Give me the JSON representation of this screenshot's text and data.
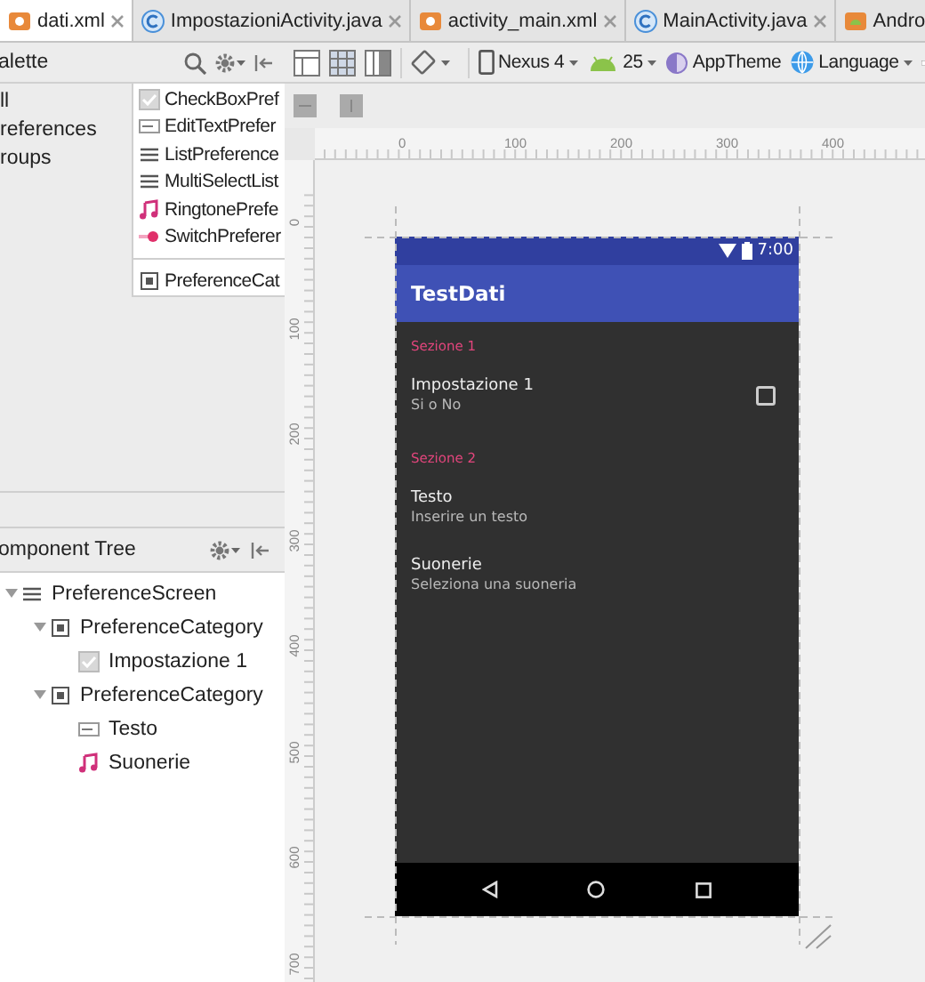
{
  "tabs": [
    {
      "kind": "xml",
      "label": "dati.xml",
      "selected": true,
      "closable": true
    },
    {
      "kind": "class",
      "label": "ImpostazioniActivity.java",
      "selected": false,
      "closable": true
    },
    {
      "kind": "xml",
      "label": "activity_main.xml",
      "selected": false,
      "closable": true
    },
    {
      "kind": "class",
      "label": "MainActivity.java",
      "selected": false,
      "closable": true
    },
    {
      "kind": "android",
      "label": "Andro",
      "selected": false,
      "closable": false
    }
  ],
  "palette": {
    "title": "alette",
    "categories": [
      "ll",
      "references",
      "roups"
    ],
    "groups": [
      [
        {
          "kind": "checkbox",
          "label": "CheckBoxPref"
        },
        {
          "kind": "edittext",
          "label": "EditTextPrefer"
        },
        {
          "kind": "list",
          "label": "ListPreference"
        },
        {
          "kind": "list",
          "label": "MultiSelectList"
        },
        {
          "kind": "ringtone",
          "label": "RingtonePrefe"
        },
        {
          "kind": "switch",
          "label": "SwitchPreferer"
        }
      ],
      [
        {
          "kind": "category",
          "label": "PreferenceCat"
        }
      ]
    ]
  },
  "component_tree": {
    "title": "omponent Tree",
    "nodes": [
      {
        "kind": "screen",
        "label": "PreferenceScreen",
        "expanded": true,
        "children": [
          {
            "kind": "category",
            "label": "PreferenceCategory",
            "expanded": true,
            "children": [
              {
                "kind": "checkbox",
                "label": "Impostazione 1"
              }
            ]
          },
          {
            "kind": "category",
            "label": "PreferenceCategory",
            "expanded": true,
            "children": [
              {
                "kind": "edittext",
                "label": "Testo"
              },
              {
                "kind": "ringtone",
                "label": "Suonerie"
              }
            ]
          }
        ]
      }
    ]
  },
  "toolbar": {
    "device": "Nexus 4",
    "api": "25",
    "theme": "AppTheme",
    "language": "Language"
  },
  "rulers": {
    "horizontal": [
      "0",
      "100",
      "200",
      "300",
      "400"
    ],
    "vertical": [
      "0",
      "100",
      "200",
      "300",
      "400",
      "500",
      "600",
      "700"
    ]
  },
  "phone": {
    "time": "7:00",
    "app_title": "TestDati",
    "sections": [
      {
        "title": "Sezione 1",
        "items": [
          {
            "kind": "checkbox",
            "title": "Impostazione 1",
            "summary": "Si o No",
            "checked": false
          }
        ]
      },
      {
        "title": "Sezione 2",
        "items": [
          {
            "kind": "edittext",
            "title": "Testo",
            "summary": "Inserire un testo"
          },
          {
            "kind": "ringtone",
            "title": "Suonerie",
            "summary": "Seleziona una suoneria"
          }
        ]
      }
    ]
  }
}
